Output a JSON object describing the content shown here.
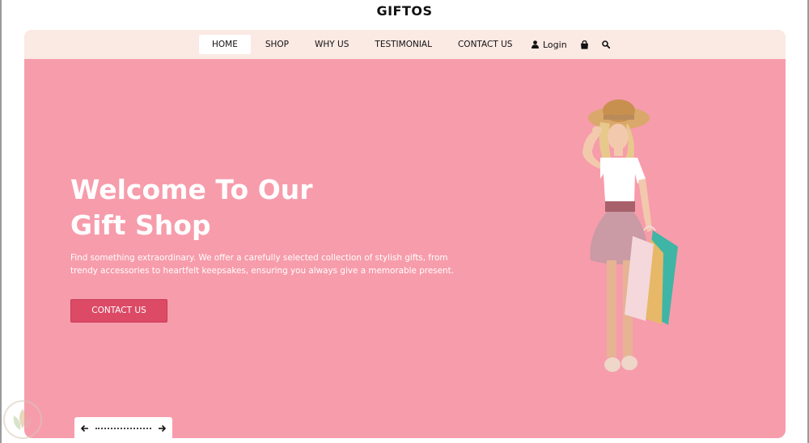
{
  "brand": "GIFTOS",
  "nav": {
    "items": [
      {
        "label": "HOME",
        "active": true
      },
      {
        "label": "SHOP",
        "active": false
      },
      {
        "label": "WHY US",
        "active": false
      },
      {
        "label": "TESTIMONIAL",
        "active": false
      },
      {
        "label": "CONTACT US",
        "active": false
      }
    ],
    "login_label": "Login",
    "icons": [
      "user-icon",
      "shopping-bag-icon",
      "search-icon"
    ]
  },
  "hero": {
    "title_line1": "Welcome To Our",
    "title_line2": "Gift Shop",
    "description": "Find something extraordinary. We offer a carefully selected collection of stylish gifts, from trendy accessories to heartfelt keepsakes, ensuring you always give a memorable present.",
    "cta_label": "CONTACT US",
    "image": "girl-with-shopping-bags"
  },
  "slider": {
    "icons": [
      "arrow-left-icon",
      "arrow-right-icon"
    ]
  },
  "colors": {
    "hero_bg": "#f79cab",
    "nav_bg": "#fbe9e4",
    "button": "#dc4a66"
  }
}
